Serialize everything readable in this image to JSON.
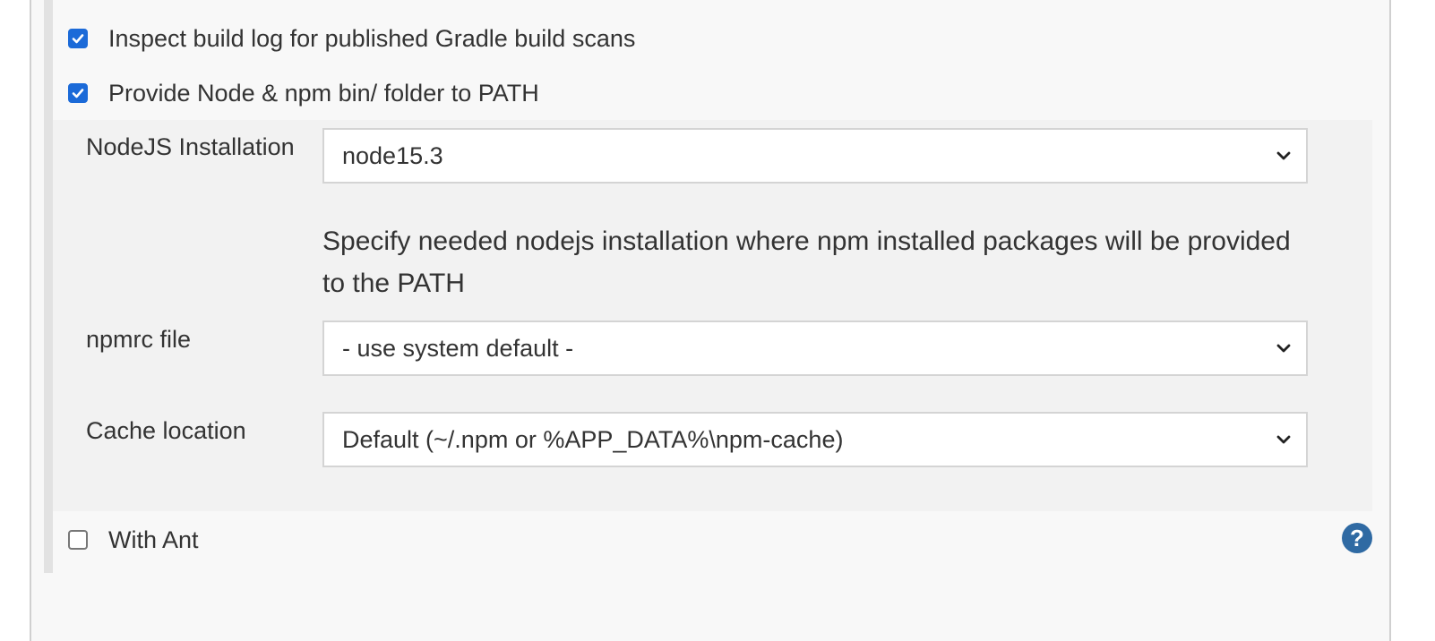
{
  "options": {
    "inspect_build_log": {
      "label": "Inspect build log for published Gradle build scans",
      "checked": true
    },
    "provide_node": {
      "label": "Provide Node & npm bin/ folder to PATH",
      "checked": true
    },
    "with_ant": {
      "label": "With Ant",
      "checked": false
    }
  },
  "node_settings": {
    "installation": {
      "label": "NodeJS Installation",
      "value": "node15.3",
      "help": "Specify needed nodejs installation where npm installed packages will be provided to the PATH"
    },
    "npmrc": {
      "label": "npmrc file",
      "value": "- use system default -"
    },
    "cache": {
      "label": "Cache location",
      "value": "Default (~/.npm or %APP_DATA%\\npm-cache)"
    }
  },
  "help_icon": {
    "glyph": "?",
    "name": "question-icon"
  },
  "colors": {
    "checkbox_checked": "#1b6ad8",
    "help_icon": "#2f6aa3",
    "panel_background": "#f8f8f8",
    "nested_background": "#f2f2f2"
  }
}
